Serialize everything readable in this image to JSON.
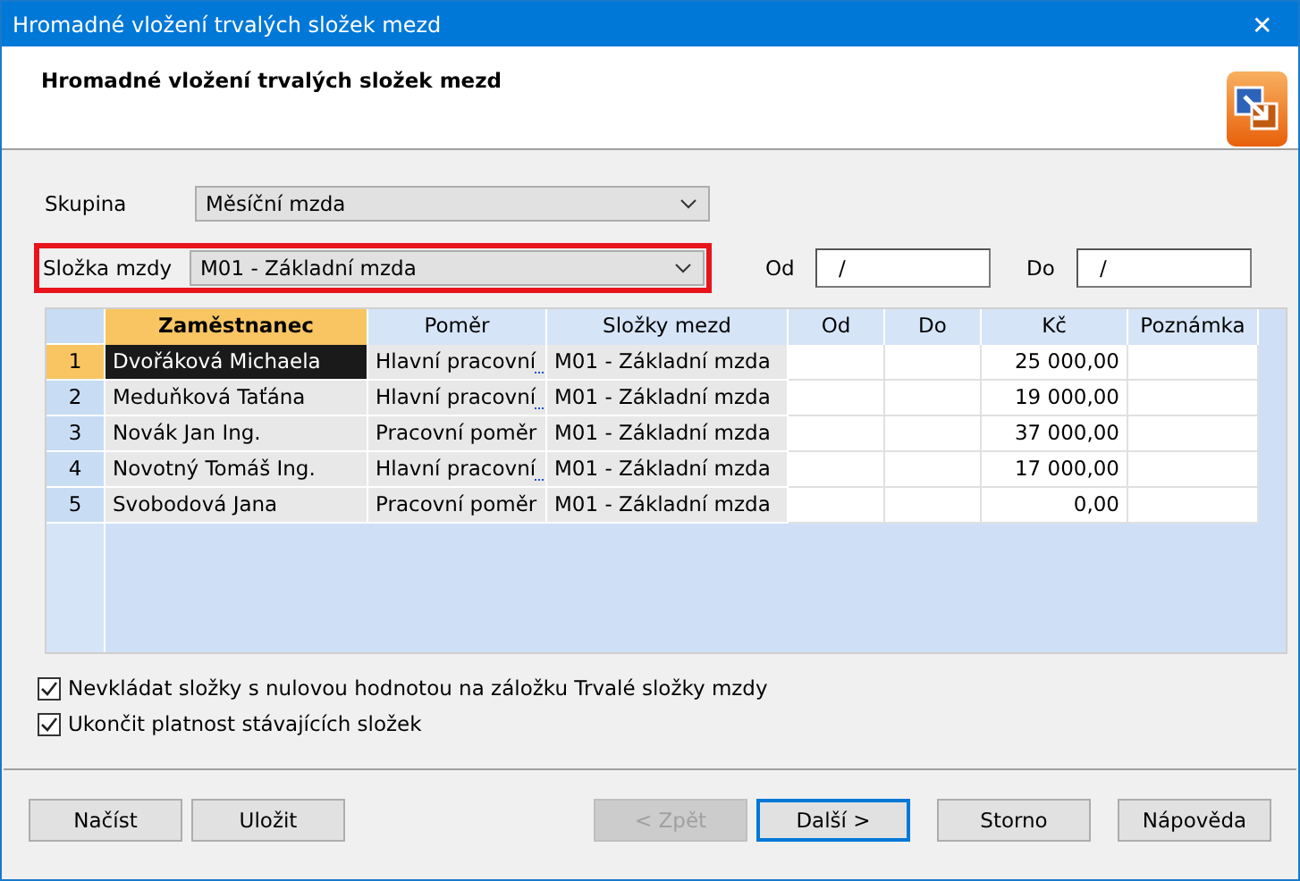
{
  "window": {
    "title": "Hromadné vložení trvalých složek mezd",
    "close": "✕"
  },
  "header": {
    "title": "Hromadné vložení trvalých složek mezd"
  },
  "skupina": {
    "label": "Skupina",
    "value": "Měsíční mzda"
  },
  "slozka": {
    "label": "Složka mzdy",
    "value": "M01 - Základní mzda",
    "highlighted": true
  },
  "od": {
    "label": "Od",
    "value": "/"
  },
  "do": {
    "label": "Do",
    "value": "/"
  },
  "table": {
    "columns": [
      "Zaměstnanec",
      "Poměr",
      "Složky mezd",
      "Od",
      "Do",
      "Kč",
      "Poznámka"
    ],
    "rows": [
      {
        "number": "1",
        "selected": true,
        "cells": [
          "Dvořáková Michaela",
          "Hlavní pracovní",
          "M01 - Základní mzda",
          "",
          "",
          "25 000,00",
          ""
        ],
        "truncated": true
      },
      {
        "number": "2",
        "selected": false,
        "cells": [
          "Meduňková Taťána",
          "Hlavní pracovní",
          "M01 - Základní mzda",
          "",
          "",
          "19 000,00",
          ""
        ],
        "truncated": true
      },
      {
        "number": "3",
        "selected": false,
        "cells": [
          "Novák Jan Ing.",
          "Pracovní poměr",
          "M01 - Základní mzda",
          "",
          "",
          "37 000,00",
          ""
        ],
        "truncated": false
      },
      {
        "number": "4",
        "selected": false,
        "cells": [
          "Novotný Tomáš Ing.",
          "Hlavní pracovní",
          "M01 - Základní mzda",
          "",
          "",
          "17 000,00",
          ""
        ],
        "truncated": true
      },
      {
        "number": "5",
        "selected": false,
        "cells": [
          "Svobodová Jana",
          "Pracovní poměr",
          "M01 - Základní mzda",
          "",
          "",
          "0,00",
          ""
        ],
        "truncated": false
      }
    ]
  },
  "options": [
    {
      "label": "Nevkládat složky s nulovou hodnotou na záložku Trvalé složky mzdy",
      "checked": true
    },
    {
      "label": "Ukončit platnost stávajících složek",
      "checked": true
    }
  ],
  "buttons_left": [
    {
      "label": "Načíst",
      "disabled": false,
      "default": false
    },
    {
      "label": "Uložit",
      "disabled": false,
      "default": false
    }
  ],
  "buttons_right": [
    {
      "label": "< Zpět",
      "disabled": true,
      "default": false
    },
    {
      "label": "Další >",
      "disabled": false,
      "default": true
    },
    {
      "label": "Storno",
      "disabled": false,
      "default": false
    },
    {
      "label": "Nápověda",
      "disabled": false,
      "default": false
    }
  ]
}
